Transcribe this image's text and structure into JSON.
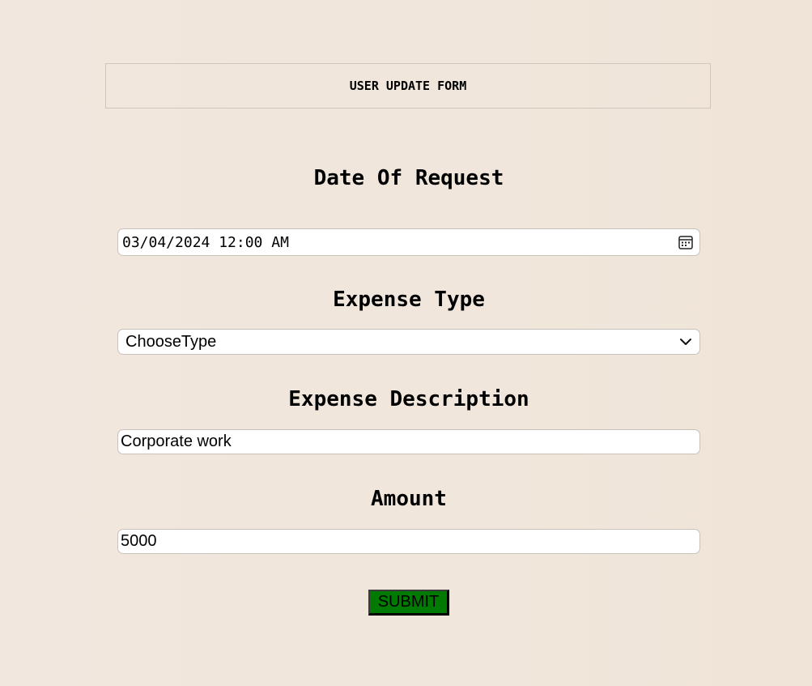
{
  "header": {
    "title": "USER UPDATE FORM"
  },
  "form": {
    "date": {
      "label": "Date Of Request",
      "value": "03/04/2024 12:00 AM",
      "icon": "calendar-icon"
    },
    "expense_type": {
      "label": "Expense Type",
      "selected": "ChooseType",
      "icon": "chevron-down-icon"
    },
    "description": {
      "label": "Expense Description",
      "value": "Corporate work"
    },
    "amount": {
      "label": "Amount",
      "value": "5000"
    },
    "submit_label": "SUBMIT"
  },
  "colors": {
    "background": "#f1e7de",
    "submit_bg": "#007a00",
    "field_bg": "#ffffff"
  }
}
